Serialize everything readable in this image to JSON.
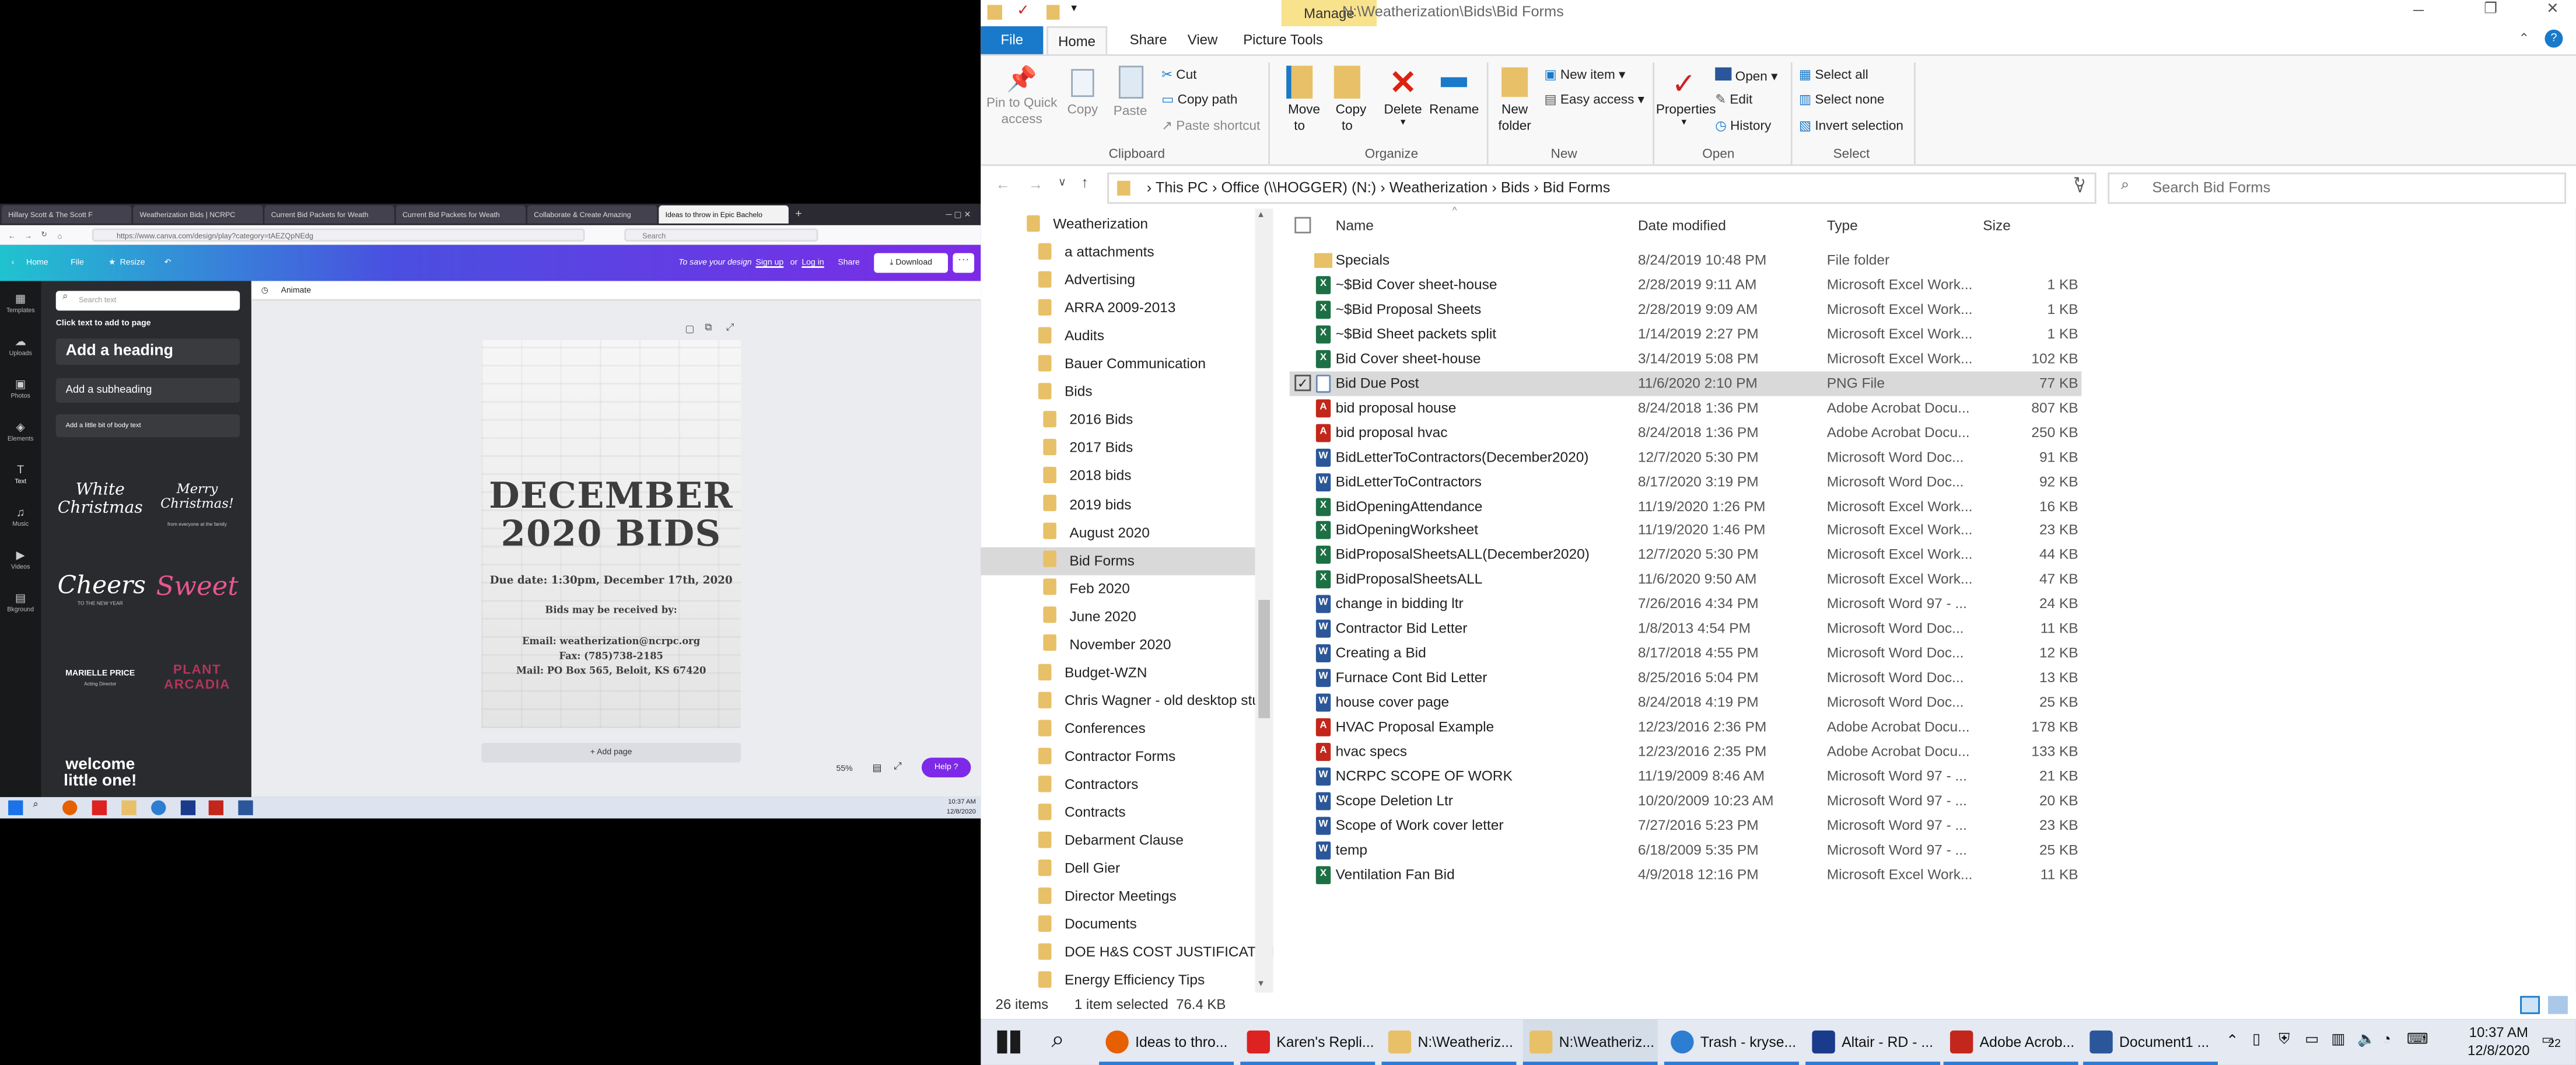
{
  "browser": {
    "tabs": [
      "Hillary Scott & The Scott F",
      "Weatherization Bids | NCRPC",
      "Current Bid Packets for Weath",
      "Current Bid Packets for Weath",
      "Collaborate & Create Amazing",
      "Ideas to throw in Epic Bachelo"
    ],
    "url": "https://www.canva.com/design/play?category=tAEZQpNEdg",
    "search_placeholder": "Search"
  },
  "canva": {
    "home": "Home",
    "file": "File",
    "resize": "Resize",
    "save_msg_prefix": "To save your design",
    "signup": "Sign up",
    "or": "or",
    "login": "Log in",
    "share": "Share",
    "download": "Download",
    "rail": [
      "Templates",
      "Uploads",
      "Photos",
      "Elements",
      "Text",
      "Music",
      "Videos",
      "Bkground"
    ],
    "search_placeholder": "Search text",
    "click_text": "Click text to add to page",
    "heading": "Add a heading",
    "subheading": "Add a subheading",
    "body_text": "Add a little bit of body text",
    "samples": [
      "White Christmas",
      "Merry Christmas!",
      "Cheers",
      "Sweet",
      "MARIELLE PRICE",
      "PLANT ARCADIA",
      "welcome little one!"
    ],
    "sample_subs": [
      "from everyone at the family",
      "TO THE NEW YEAR",
      "Acting Director"
    ],
    "animate": "Animate",
    "poster": {
      "title_line1": "DECEMBER",
      "title_line2": "2020 BIDS",
      "due": "Due date: 1:30pm, December 17th, 2020",
      "received": "Bids may be received by:",
      "email": "Email:  weatherization@ncrpc.org",
      "fax": "Fax:  (785)738-2185",
      "mail": "Mail: PO Box 565, Beloit, KS 67420"
    },
    "add_page": "+ Add page",
    "zoom": "55%",
    "help": "Help ?",
    "time": "10:37 AM",
    "date": "12/8/2020"
  },
  "explorer": {
    "title_path": "N:\\Weatherization\\Bids\\Bid Forms",
    "manage": "Manage",
    "tabs": [
      "File",
      "Home",
      "Share",
      "View",
      "Picture Tools"
    ],
    "ribbon": {
      "pin": "Pin to Quick access",
      "copy": "Copy",
      "paste": "Paste",
      "cut": "Cut",
      "copy_path": "Copy path",
      "paste_shortcut": "Paste shortcut",
      "move_to": "Move to",
      "copy_to": "Copy to",
      "delete": "Delete",
      "rename": "Rename",
      "new_folder": "New folder",
      "new_item": "New item",
      "easy_access": "Easy access",
      "properties": "Properties",
      "open": "Open",
      "edit": "Edit",
      "history": "History",
      "select_all": "Select all",
      "select_none": "Select none",
      "invert_selection": "Invert selection",
      "groups": [
        "Clipboard",
        "Organize",
        "New",
        "Open",
        "Select"
      ]
    },
    "breadcrumb": [
      "This PC",
      "Office (\\\\HOGGER) (N:)",
      "Weatherization",
      "Bids",
      "Bid Forms"
    ],
    "search_placeholder": "Search Bid Forms",
    "nav": [
      "Weatherization",
      "a attachments",
      "Advertising",
      "ARRA 2009-2013",
      "Audits",
      "Bauer Communication",
      "Bids",
      "2016 Bids",
      "2017 Bids",
      "2018 bids",
      "2019 bids",
      "August 2020",
      "Bid Forms",
      "Feb 2020",
      "June 2020",
      "November 2020",
      "Budget-WZN",
      "Chris Wagner - old desktop stuff",
      "Conferences",
      "Contractor Forms",
      "Contractors",
      "Contracts",
      "Debarment Clause",
      "Dell Gier",
      "Director Meetings",
      "Documents",
      "DOE H&S COST JUSTIFICATION",
      "Energy Efficiency Tips"
    ],
    "columns": [
      "Name",
      "Date modified",
      "Type",
      "Size"
    ],
    "files": [
      {
        "name": "Specials",
        "date": "8/24/2019 10:48 PM",
        "type": "File folder",
        "size": "",
        "kind": "folder"
      },
      {
        "name": "~$Bid Cover sheet-house",
        "date": "2/28/2019 9:11 AM",
        "type": "Microsoft Excel Work...",
        "size": "1 KB",
        "kind": "xls"
      },
      {
        "name": "~$Bid Proposal Sheets",
        "date": "2/28/2019 9:09 AM",
        "type": "Microsoft Excel Work...",
        "size": "1 KB",
        "kind": "xls"
      },
      {
        "name": "~$Bid Sheet packets split",
        "date": "1/14/2019 2:27 PM",
        "type": "Microsoft Excel Work...",
        "size": "1 KB",
        "kind": "xls"
      },
      {
        "name": "Bid Cover sheet-house",
        "date": "3/14/2019 5:08 PM",
        "type": "Microsoft Excel Work...",
        "size": "102 KB",
        "kind": "xls"
      },
      {
        "name": "Bid Due Post",
        "date": "11/6/2020 2:10 PM",
        "type": "PNG File",
        "size": "77 KB",
        "kind": "png"
      },
      {
        "name": "bid proposal house",
        "date": "8/24/2018 1:36 PM",
        "type": "Adobe Acrobat Docu...",
        "size": "807 KB",
        "kind": "pdf"
      },
      {
        "name": "bid proposal hvac",
        "date": "8/24/2018 1:36 PM",
        "type": "Adobe Acrobat Docu...",
        "size": "250 KB",
        "kind": "pdf"
      },
      {
        "name": "BidLetterToContractors(December2020)",
        "date": "12/7/2020 5:30 PM",
        "type": "Microsoft Word Doc...",
        "size": "91 KB",
        "kind": "doc"
      },
      {
        "name": "BidLetterToContractors",
        "date": "8/17/2020 3:19 PM",
        "type": "Microsoft Word Doc...",
        "size": "92 KB",
        "kind": "doc"
      },
      {
        "name": "BidOpeningAttendance",
        "date": "11/19/2020 1:26 PM",
        "type": "Microsoft Excel Work...",
        "size": "16 KB",
        "kind": "xls"
      },
      {
        "name": "BidOpeningWorksheet",
        "date": "11/19/2020 1:46 PM",
        "type": "Microsoft Excel Work...",
        "size": "23 KB",
        "kind": "xls"
      },
      {
        "name": "BidProposalSheetsALL(December2020)",
        "date": "12/7/2020 5:30 PM",
        "type": "Microsoft Excel Work...",
        "size": "44 KB",
        "kind": "xls"
      },
      {
        "name": "BidProposalSheetsALL",
        "date": "11/6/2020 9:50 AM",
        "type": "Microsoft Excel Work...",
        "size": "47 KB",
        "kind": "xls"
      },
      {
        "name": "change in bidding ltr",
        "date": "7/26/2016 4:34 PM",
        "type": "Microsoft Word 97 - ...",
        "size": "24 KB",
        "kind": "doc"
      },
      {
        "name": "Contractor Bid Letter",
        "date": "1/8/2013 4:54 PM",
        "type": "Microsoft Word Doc...",
        "size": "11 KB",
        "kind": "doc"
      },
      {
        "name": "Creating a Bid",
        "date": "8/17/2018 4:55 PM",
        "type": "Microsoft Word Doc...",
        "size": "12 KB",
        "kind": "doc"
      },
      {
        "name": "Furnace Cont Bid Letter",
        "date": "8/25/2016 5:04 PM",
        "type": "Microsoft Word Doc...",
        "size": "13 KB",
        "kind": "doc"
      },
      {
        "name": "house cover page",
        "date": "8/24/2018 4:19 PM",
        "type": "Microsoft Word Doc...",
        "size": "25 KB",
        "kind": "doc"
      },
      {
        "name": "HVAC Proposal Example",
        "date": "12/23/2016 2:36 PM",
        "type": "Adobe Acrobat Docu...",
        "size": "178 KB",
        "kind": "pdf"
      },
      {
        "name": "hvac specs",
        "date": "12/23/2016 2:35 PM",
        "type": "Adobe Acrobat Docu...",
        "size": "133 KB",
        "kind": "pdf"
      },
      {
        "name": "NCRPC SCOPE OF WORK",
        "date": "11/19/2009 8:46 AM",
        "type": "Microsoft Word 97 - ...",
        "size": "21 KB",
        "kind": "doc"
      },
      {
        "name": "Scope Deletion Ltr",
        "date": "10/20/2009 10:23 AM",
        "type": "Microsoft Word 97 - ...",
        "size": "20 KB",
        "kind": "doc"
      },
      {
        "name": "Scope of Work cover letter",
        "date": "7/27/2016 5:23 PM",
        "type": "Microsoft Word 97 - ...",
        "size": "23 KB",
        "kind": "doc"
      },
      {
        "name": "temp",
        "date": "6/18/2009 5:35 PM",
        "type": "Microsoft Word 97 - ...",
        "size": "25 KB",
        "kind": "doc"
      },
      {
        "name": "Ventilation Fan Bid",
        "date": "4/9/2018 12:16 PM",
        "type": "Microsoft Excel Work...",
        "size": "11 KB",
        "kind": "xls"
      }
    ],
    "status_items": "26 items",
    "status_selected": "1 item selected  76.4 KB"
  },
  "taskbar": {
    "apps": [
      "Ideas to thro...",
      "Karen's Repli...",
      "N:\\Weatheriz...",
      "N:\\Weatheriz...",
      "Trash - kryse...",
      "Altair - RD - ...",
      "Adobe Acrob...",
      "Document1 ..."
    ],
    "time": "10:37 AM",
    "date": "12/8/2020",
    "notif": "22"
  },
  "colors": {
    "explorer_accent": "#1979ca",
    "manage_tab": "#f8e28c",
    "canva_purple": "#7d2ae8",
    "excel": "#1d7044",
    "word": "#2b579a",
    "pdf": "#c3271b",
    "folder": "#e8c068"
  }
}
